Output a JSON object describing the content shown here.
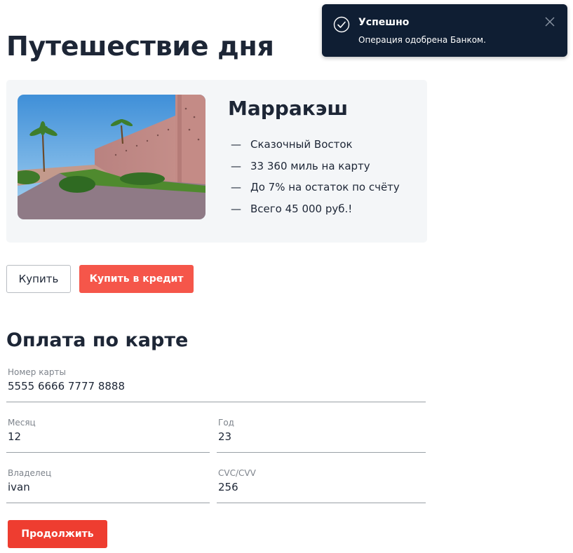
{
  "page": {
    "title": "Путешествие дня"
  },
  "trip": {
    "name": "Марракэш",
    "features": [
      "Сказочный Восток",
      "33 360 миль на карту",
      "До 7% на остаток по счёту",
      "Всего 45 000 руб.!"
    ],
    "bullet": "—"
  },
  "actions": {
    "buy_label": "Купить",
    "credit_label": "Купить в кредит"
  },
  "payment": {
    "title": "Оплата по карте",
    "card_number": {
      "label": "Номер карты",
      "value": "5555 6666 7777 8888"
    },
    "month": {
      "label": "Месяц",
      "value": "12"
    },
    "year": {
      "label": "Год",
      "value": "23"
    },
    "owner": {
      "label": "Владелец",
      "value": "ivan"
    },
    "cvc": {
      "label": "CVC/CVV",
      "value": "256"
    },
    "continue_label": "Продолжить"
  },
  "notification": {
    "title": "Успешно",
    "message": "Операция одобрена Банком.",
    "icon": "check-circle-icon",
    "close_icon": "close-icon"
  },
  "colors": {
    "accent_red": "#f5564a",
    "continue_red": "#ee3d30",
    "toast_bg": "#0f1e33",
    "card_bg": "#f4f6f8"
  }
}
